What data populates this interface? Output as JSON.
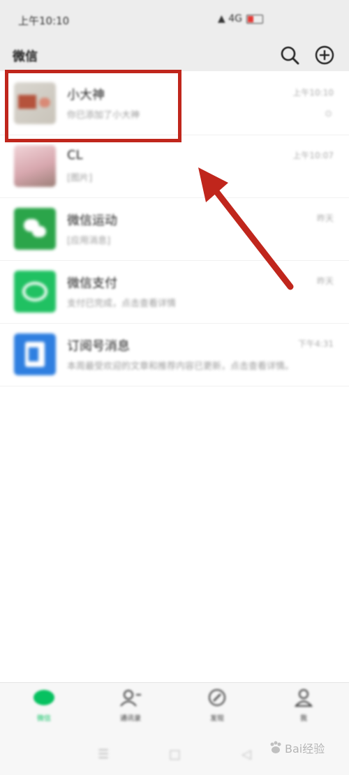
{
  "status_bar": {
    "time": "上午10:10",
    "icons_text": "▲ 4G"
  },
  "header": {
    "title": "微信",
    "search_icon": "search-icon",
    "add_icon": "plus-circle-icon"
  },
  "chats": [
    {
      "title": "小大神",
      "preview": "你已添加了小大神",
      "time": "上午10:10",
      "mute": "⊙",
      "avatar": "photo-avatar"
    },
    {
      "title": "CL",
      "preview": "[图片]",
      "time": "上午10:07",
      "mute": "",
      "avatar": "pink-photo-avatar"
    },
    {
      "title": "微信运动",
      "preview": "[应用消息]",
      "time": "昨天",
      "mute": "",
      "avatar": "wechat-sports-icon"
    },
    {
      "title": "微信支付",
      "preview": "支付已完成，点击查看详情",
      "time": "昨天",
      "mute": "",
      "avatar": "wechat-pay-icon"
    },
    {
      "title": "订阅号消息",
      "preview": "本周最受欢迎的文章和推荐内容已更新，点击查看详情。",
      "time": "下午4:31",
      "mute": "",
      "avatar": "subscription-icon"
    }
  ],
  "tabs": [
    {
      "label": "微信",
      "active": true
    },
    {
      "label": "通讯录",
      "active": false
    },
    {
      "label": "发现",
      "active": false
    },
    {
      "label": "我",
      "active": false
    }
  ],
  "nav": {
    "menu": "☰",
    "home": "□",
    "back": "◁"
  },
  "watermark": {
    "text": "Bai经验"
  },
  "colors": {
    "accent": "#07c160",
    "highlight": "#c0261c",
    "header_bg": "#ededed"
  }
}
